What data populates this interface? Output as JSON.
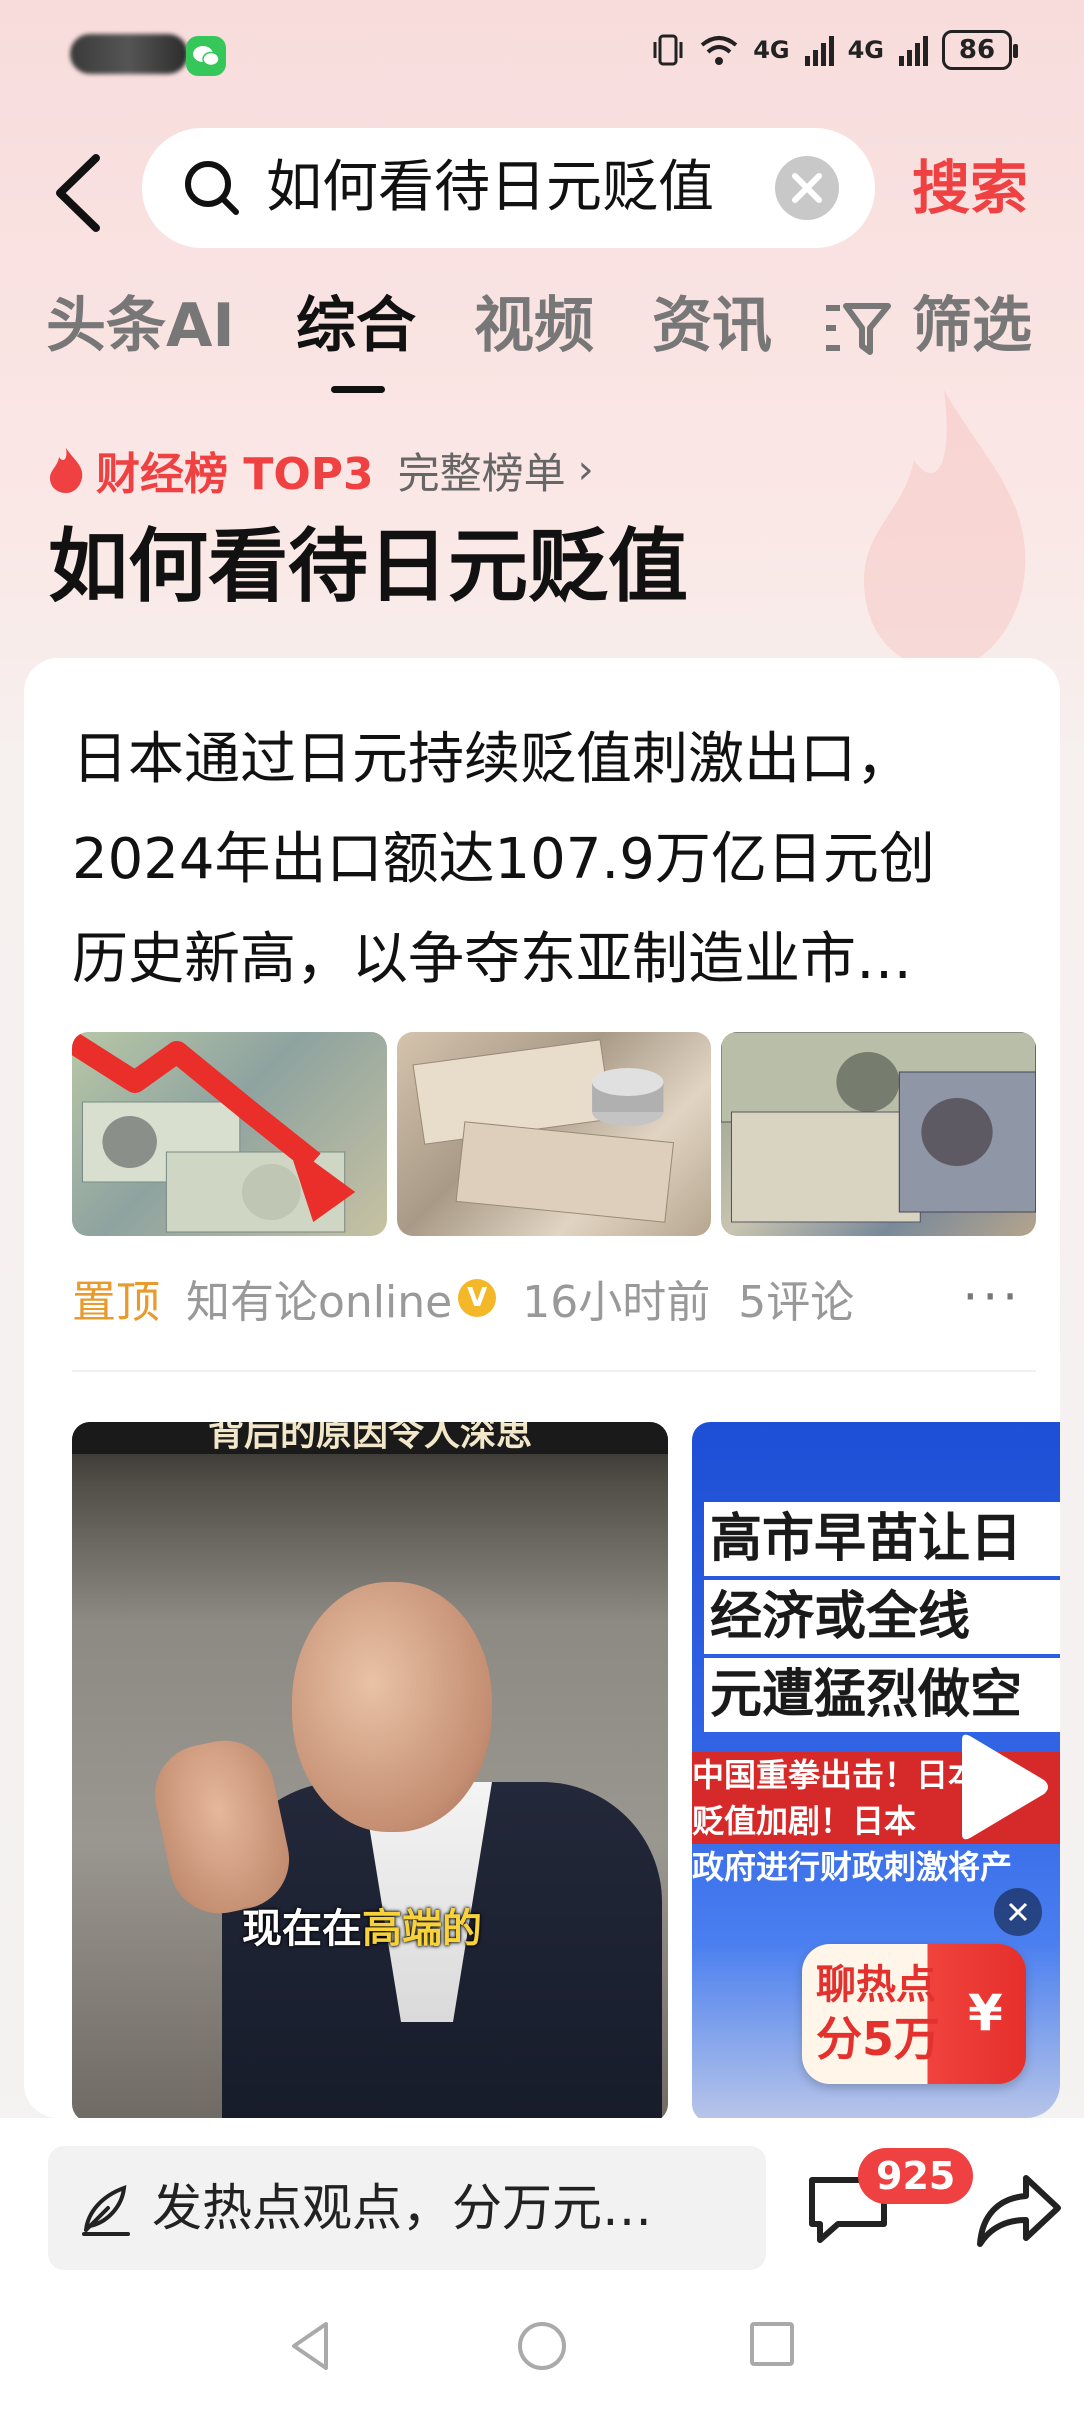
{
  "status_bar": {
    "network_1": "4G",
    "network_2": "4G",
    "battery": "86",
    "colors": {
      "wechat": "#35c759"
    }
  },
  "search": {
    "query": "如何看待日元贬值",
    "submit_label": "搜索"
  },
  "tabs": [
    {
      "label": "头条AI"
    },
    {
      "label": "综合",
      "active": true
    },
    {
      "label": "视频"
    },
    {
      "label": "资讯"
    },
    {
      "label": "筛选"
    }
  ],
  "ranking": {
    "label": "财经榜 TOP3",
    "link": "完整榜单",
    "topic_title": "如何看待日元贬值"
  },
  "article": {
    "title_lines": [
      "日本通过日元持续贬值刺激出口，",
      "2024年出口额达107.9万亿日元创",
      "历史新高，以争夺东亚制造业市…"
    ],
    "pinned": "置顶",
    "author": "知有论online",
    "time": "16小时前",
    "comments": "5评论",
    "thumbnails": [
      "yen-banknotes-down-arrow",
      "yen-banknotes-coins",
      "dollar-and-yen-banknotes"
    ]
  },
  "videos": {
    "video1": {
      "top_caption": "背后的原因令人深思",
      "subtitle_prefix": "现在在",
      "subtitle_highlight": "高端的"
    },
    "video2": {
      "headline_lines": [
        "高市早苗让日",
        "经济或全线",
        "元遭猛烈做空"
      ],
      "sub_lines": [
        "中国重拳出击！日本损",
        "贬值加剧！日本",
        "政府进行财政刺激将产"
      ],
      "promo_line1": "聊热点",
      "promo_line2": "分5万",
      "promo_currency": "¥"
    }
  },
  "bottom_bar": {
    "placeholder": "发热点观点，分万元…",
    "comment_count": "925"
  },
  "colors": {
    "accent_red": "#f04142",
    "pinned_orange": "#e89a2c",
    "verified_yellow": "#f4b727"
  }
}
